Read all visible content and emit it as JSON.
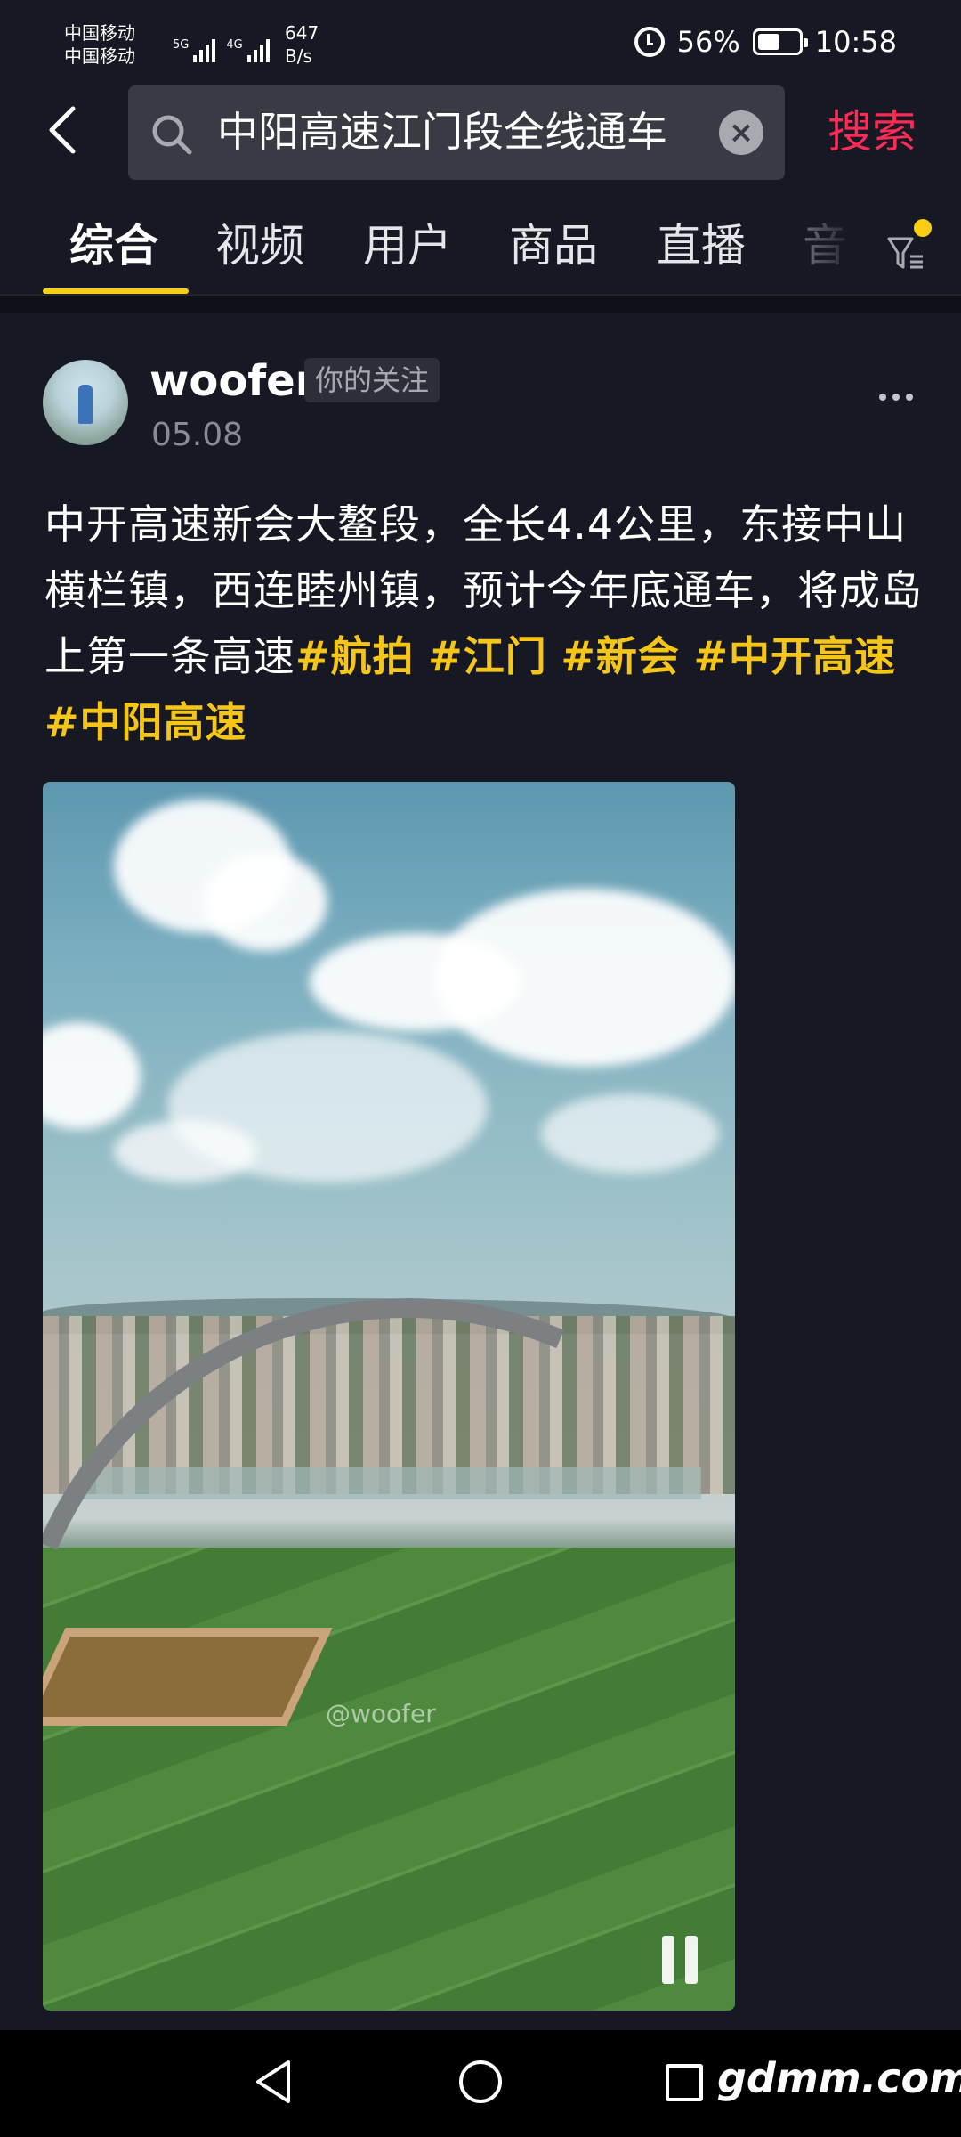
{
  "status_bar": {
    "carrier_1": "中国移动",
    "carrier_2": "中国移动",
    "net_1": "5G",
    "net_2": "4G",
    "speed_value": "647",
    "speed_unit": "B/s",
    "battery": "56%",
    "time": "10:58"
  },
  "search": {
    "query": "中阳高速江门段全线通车",
    "submit_label": "搜索"
  },
  "tabs": [
    {
      "label": "综合",
      "active": true
    },
    {
      "label": "视频"
    },
    {
      "label": "用户"
    },
    {
      "label": "商品"
    },
    {
      "label": "直播"
    },
    {
      "label": "音"
    }
  ],
  "post": {
    "username": "woofer",
    "follow_badge": "你的关注",
    "date": "05.08",
    "text": "中开高速新会大鳌段，全长4.4公里，东接中山横栏镇，西连睦州镇，预计今年底通车，将成岛上第一条高速",
    "hashtags": [
      "#航拍",
      "#江门",
      "#新会",
      "#中开高速",
      "#中阳高速"
    ],
    "video_watermark": "@woofer"
  },
  "nav_bar": {
    "watermark": "gdmm.com"
  },
  "colors": {
    "background": "#161823",
    "accent": "#fe2c55",
    "hashtag": "#f5c518",
    "tab_indicator": "#face15"
  },
  "icons": [
    "back-icon",
    "search-icon",
    "clear-icon",
    "filter-icon",
    "more-icon",
    "pause-icon",
    "alarm-icon",
    "battery-icon"
  ]
}
